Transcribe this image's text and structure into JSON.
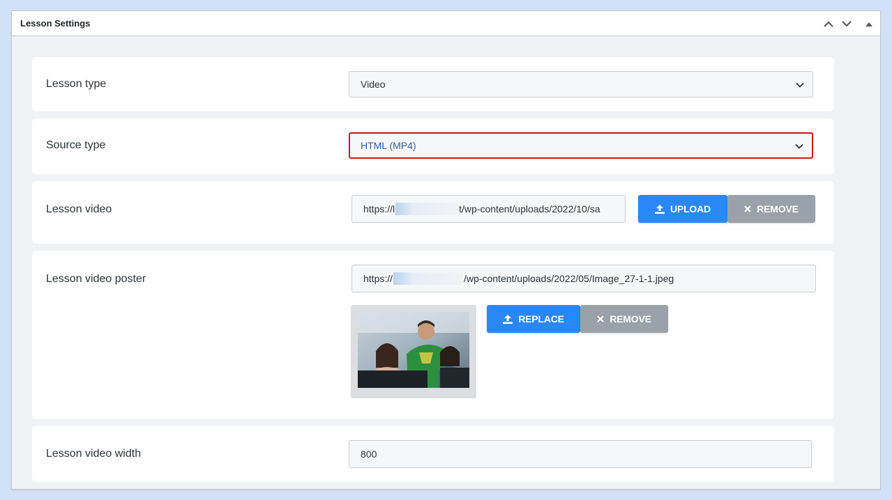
{
  "panel": {
    "title": "Lesson Settings",
    "controls": [
      "chevron-up-icon",
      "chevron-down-icon",
      "collapse-triangle-icon"
    ]
  },
  "lesson_type": {
    "label": "Lesson type",
    "value": "Video"
  },
  "source_type": {
    "label": "Source type",
    "value": "HTML (MP4)",
    "highlight_color": "#d4121b"
  },
  "lesson_video": {
    "label": "Lesson video",
    "url_prefix": "https://l",
    "url_suffix": "t/wp-content/uploads/2022/10/sa",
    "upload_label": "UPLOAD",
    "remove_label": "REMOVE"
  },
  "lesson_video_poster": {
    "label": "Lesson video poster",
    "url_prefix": "https://",
    "url_suffix": "/wp-content/uploads/2022/05/Image_27-1-1.jpeg",
    "replace_label": "REPLACE",
    "remove_label": "REMOVE"
  },
  "lesson_video_width": {
    "label": "Lesson video width",
    "value": "800"
  },
  "colors": {
    "primary": "#2a87f7",
    "secondary": "#9aa1a9",
    "background": "#d3e1f8"
  }
}
